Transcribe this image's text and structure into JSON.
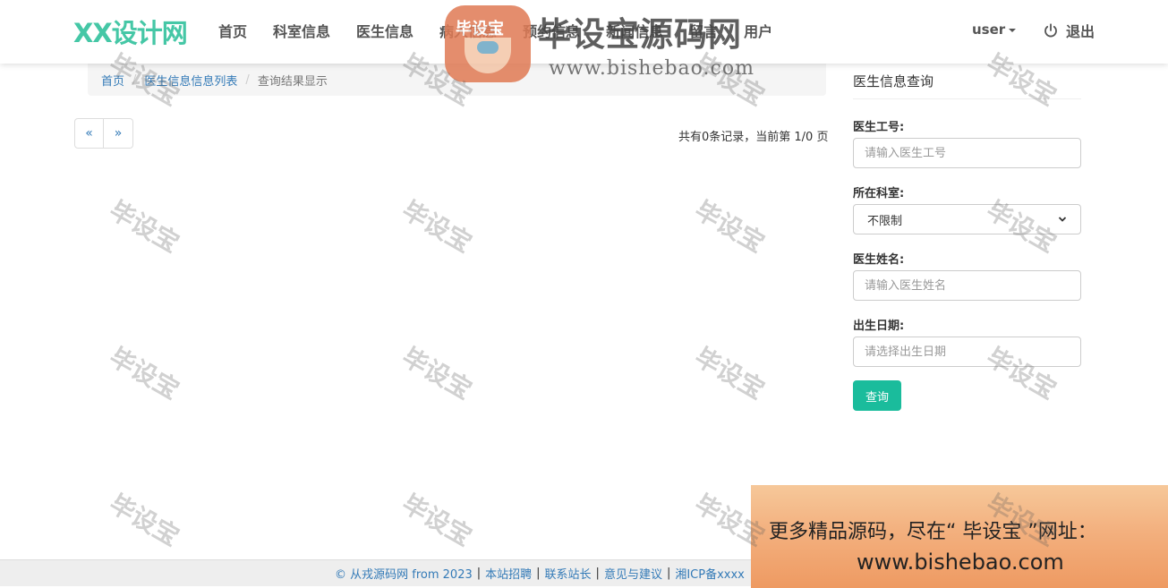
{
  "navbar": {
    "brand": "XX设计网",
    "items": [
      {
        "label": "首页"
      },
      {
        "label": "科室信息"
      },
      {
        "label": "医生信息"
      },
      {
        "label": "病人信息"
      },
      {
        "label": "预约信息"
      },
      {
        "label": "新闻信息"
      },
      {
        "label": "留言"
      },
      {
        "label": "用户"
      }
    ],
    "user_label": "user",
    "logout_label": "退出"
  },
  "breadcrumb": {
    "home": "首页",
    "list": "医生信息信息列表",
    "current": "查询结果显示",
    "separator": "/"
  },
  "pagination": {
    "prev": "«",
    "next": "»",
    "info": "共有0条记录，当前第 1/0 页"
  },
  "query_form": {
    "title": "医生信息查询",
    "doctor_no_label": "医生工号:",
    "doctor_no_placeholder": "请输入医生工号",
    "department_label": "所在科室:",
    "department_value": "不限制",
    "name_label": "医生姓名:",
    "name_placeholder": "请输入医生姓名",
    "birthday_label": "出生日期:",
    "birthday_placeholder": "请选择出生日期",
    "submit_label": "查询"
  },
  "footer": {
    "copyright": "© 从戎源码网 from 2023",
    "links": [
      "本站招聘",
      "联系站长",
      "意见与建议",
      "湘ICP备xxxx"
    ]
  },
  "watermark": {
    "badge": "毕设宝",
    "title": "毕设宝源码网",
    "url": "www.bishebao.com",
    "tile_text": "毕设宝"
  },
  "promo": {
    "line1": "更多精品源码，尽在“ 毕设宝 ”网址：",
    "line2": "www.bishebao.com"
  },
  "colors": {
    "brand": "#45c7a6",
    "link": "#337ab7",
    "button": "#1abc9c"
  }
}
